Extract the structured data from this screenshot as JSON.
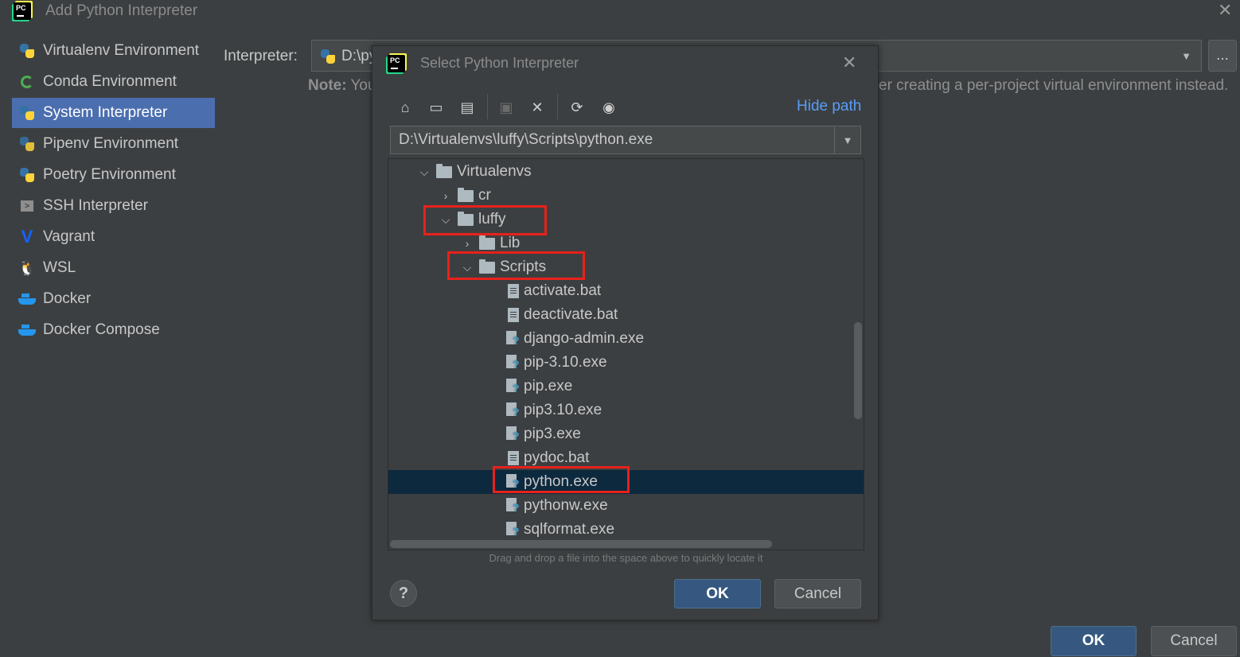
{
  "window": {
    "title": "Add Python Interpreter",
    "logo_text": "PC"
  },
  "sidebar": {
    "items": [
      {
        "label": "Virtualenv Environment",
        "icon": "python-icon"
      },
      {
        "label": "Conda Environment",
        "icon": "conda-icon"
      },
      {
        "label": "System Interpreter",
        "icon": "python-icon",
        "selected": true
      },
      {
        "label": "Pipenv Environment",
        "icon": "pipenv-icon"
      },
      {
        "label": "Poetry Environment",
        "icon": "poetry-icon"
      },
      {
        "label": "SSH Interpreter",
        "icon": "ssh-icon"
      },
      {
        "label": "Vagrant",
        "icon": "vagrant-icon"
      },
      {
        "label": "WSL",
        "icon": "linux-icon"
      },
      {
        "label": "Docker",
        "icon": "docker-icon"
      },
      {
        "label": "Docker Compose",
        "icon": "docker-icon"
      }
    ]
  },
  "main": {
    "interpreter_label": "Interpreter:",
    "interpreter_value": "D:\\py",
    "browse_label": "...",
    "note_prefix": "Note:",
    "note_start": " You",
    "note_end": "er creating a per-project virtual environment instead."
  },
  "footer": {
    "ok_label": "OK",
    "cancel_label": "Cancel"
  },
  "dialog": {
    "title": "Select Python Interpreter",
    "hide_path_label": "Hide path",
    "path_value": "D:\\Virtualenvs\\luffy\\Scripts\\python.exe",
    "drag_hint": "Drag and drop a file into the space above to quickly locate it",
    "help_label": "?",
    "ok_label": "OK",
    "cancel_label": "Cancel",
    "tree": {
      "virtualenvs": "Virtualenvs",
      "cr": "cr",
      "luffy": "luffy",
      "lib": "Lib",
      "scripts": "Scripts",
      "files": [
        {
          "name": "activate.bat",
          "kind": "file"
        },
        {
          "name": "deactivate.bat",
          "kind": "file"
        },
        {
          "name": "django-admin.exe",
          "kind": "exe"
        },
        {
          "name": "pip-3.10.exe",
          "kind": "exe"
        },
        {
          "name": "pip.exe",
          "kind": "exe"
        },
        {
          "name": "pip3.10.exe",
          "kind": "exe"
        },
        {
          "name": "pip3.exe",
          "kind": "exe"
        },
        {
          "name": "pydoc.bat",
          "kind": "file"
        },
        {
          "name": "python.exe",
          "kind": "exe",
          "selected": true
        },
        {
          "name": "pythonw.exe",
          "kind": "exe"
        },
        {
          "name": "sqlformat.exe",
          "kind": "exe"
        }
      ]
    }
  },
  "colors": {
    "background": "#3c3f41",
    "selection": "#4b6eaf",
    "tree_selection": "#0d293e",
    "primary_button": "#365880",
    "link": "#589df6",
    "highlight_box": "#e8211b"
  }
}
